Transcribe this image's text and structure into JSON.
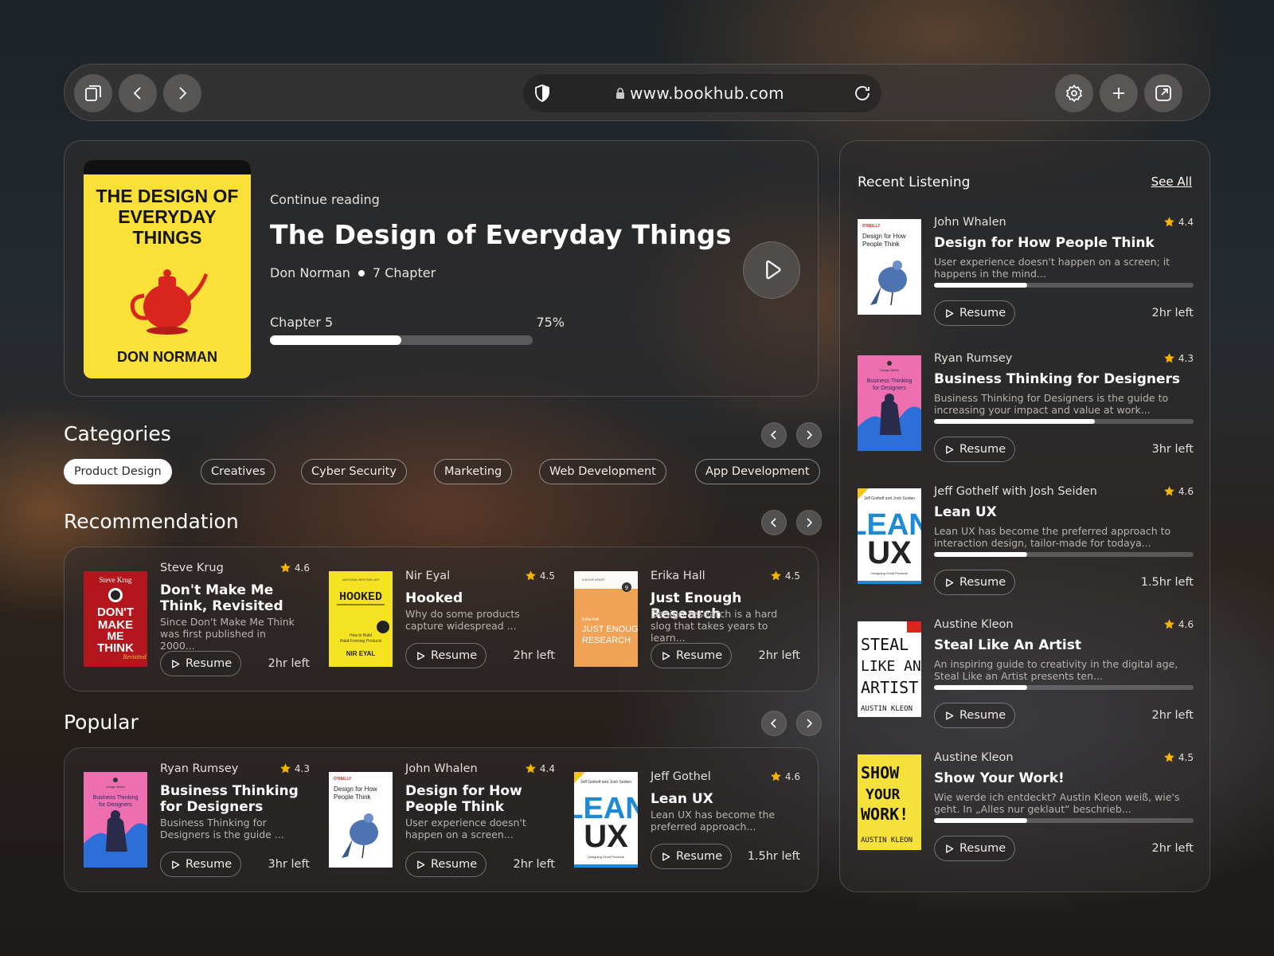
{
  "browser": {
    "url": "www.bookhub.com",
    "icons": [
      "tabs-icon",
      "back-icon",
      "forward-icon",
      "shield-icon",
      "lock-icon",
      "reload-icon",
      "settings-icon",
      "new-tab-icon",
      "expand-icon"
    ]
  },
  "hero": {
    "cover_title": "THE DESIGN OF EVERYDAY THINGS",
    "cover_author": "DON NORMAN",
    "kicker": "Continue reading",
    "title": "The Design of Everyday Things",
    "author": "Don Norman",
    "chapters": "7 Chapter",
    "current_chapter": "Chapter 5",
    "progress_label": "75%",
    "progress": 0.5
  },
  "categories": {
    "title": "Categories",
    "items": [
      "Product Design",
      "Creatives",
      "Cyber Security",
      "Marketing",
      "Web Development",
      "App Development"
    ],
    "active_index": 0
  },
  "recommendation": {
    "title": "Recommendation",
    "items": [
      {
        "author": "Steve Krug",
        "rating": "4.6",
        "title": "Don't Make Me Think, Revisited",
        "desc": "Since Don't Make Me Think was first published in 2000...",
        "resume": "Resume",
        "left": "2hr left"
      },
      {
        "author": "Nir Eyal",
        "rating": "4.5",
        "title": "Hooked",
        "desc": "Why do some products capture widespread ...",
        "resume": "Resume",
        "left": "2hr left"
      },
      {
        "author": "Erika Hall",
        "rating": "4.5",
        "title": "Just Enough Research",
        "desc": "Design research is a hard slog that takes years to learn...",
        "resume": "Resume",
        "left": "2hr left"
      }
    ]
  },
  "popular": {
    "title": "Popular",
    "items": [
      {
        "author": "Ryan Rumsey",
        "rating": "4.3",
        "title": "Business Thinking for Designers",
        "desc": "Business Thinking for Designers is the guide ...",
        "resume": "Resume",
        "left": "3hr left"
      },
      {
        "author": "John Whalen",
        "rating": "4.4",
        "title": "Design for How People Think",
        "desc": "User experience doesn't happen on a screen...",
        "resume": "Resume",
        "left": "2hr left"
      },
      {
        "author": "Jeff Gothel",
        "rating": "4.6",
        "title": "Lean UX",
        "desc": "Lean UX has become the preferred approach...",
        "resume": "Resume",
        "left": "1.5hr left"
      }
    ]
  },
  "recent": {
    "title": "Recent Listening",
    "see_all": "See All",
    "items": [
      {
        "author": "John Whalen",
        "rating": "4.4",
        "title": "Design for How People Think",
        "desc": "User experience doesn't happen on a screen; it happens in the mind...",
        "progress": 0.36,
        "resume": "Resume",
        "left": "2hr left"
      },
      {
        "author": "Ryan Rumsey",
        "rating": "4.3",
        "title": "Business Thinking for Designers",
        "desc": "Business Thinking for Designers is the guide to increasing your impact and value at work...",
        "progress": 0.62,
        "resume": "Resume",
        "left": "3hr left"
      },
      {
        "author": "Jeff Gothelf with Josh Seiden",
        "rating": "4.6",
        "title": "Lean UX",
        "desc": "Lean UX has become the preferred approach to interaction design, tailor-made for todaya...",
        "progress": 0.36,
        "resume": "Resume",
        "left": "1.5hr left"
      },
      {
        "author": "Austine Kleon",
        "rating": "4.6",
        "title": "Steal Like An Artist",
        "desc": "An inspiring guide to creativity in the digital age, Steal Like an Artist presents ten...",
        "progress": 0.36,
        "resume": "Resume",
        "left": "2hr left"
      },
      {
        "author": "Austine Kleon",
        "rating": "4.5",
        "title": "Show Your Work!",
        "desc": "Wie werde ich entdeckt? Austin Kleon weiß, wie's geht. In „Alles nur geklaut“ beschrieb...",
        "progress": 0.36,
        "resume": "Resume",
        "left": "2hr left"
      }
    ]
  },
  "colors": {
    "accent_star": "#f5b400",
    "hero_cover": "#fbe038",
    "panel": "#302c2c"
  }
}
